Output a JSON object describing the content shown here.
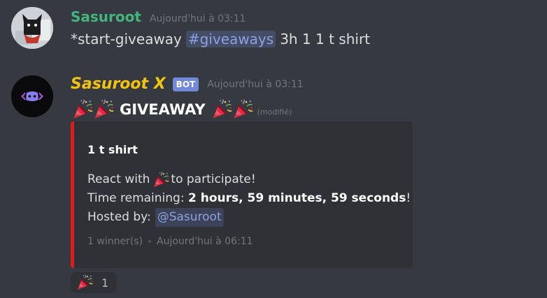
{
  "message1": {
    "username": "Sasuroot",
    "timestamp": "Aujourd'hui à 03:11",
    "content_prefix": "*start-giveaway",
    "channel_mention": "#giveaways",
    "content_suffix": "3h 1 1 t shirt"
  },
  "message2": {
    "username": "Sasuroot X",
    "bot_tag": "BOT",
    "timestamp": "Aujourd'hui à 03:11",
    "title": "GIVEAWAY",
    "edited": "(modifié)",
    "embed": {
      "accent_color": "#e01b1b",
      "title": "1 t shirt",
      "react_prefix": "React with",
      "react_suffix": "to participate!",
      "time_label": "Time remaining: ",
      "time_value": "2 hours, 59 minutes, 59 seconds",
      "time_suffix": "!",
      "hosted_label": "Hosted by:",
      "host_mention": "@Sasuroot",
      "footer_winners": "1 winner(s)",
      "footer_time": "Aujourd'hui à 06:11"
    },
    "reaction": {
      "emoji": "party-popper-icon",
      "count": "1"
    }
  },
  "colors": {
    "background": "#36393f",
    "user_green": "#43b581",
    "bot_gold": "#f1c40f",
    "blurple": "#7289da"
  }
}
